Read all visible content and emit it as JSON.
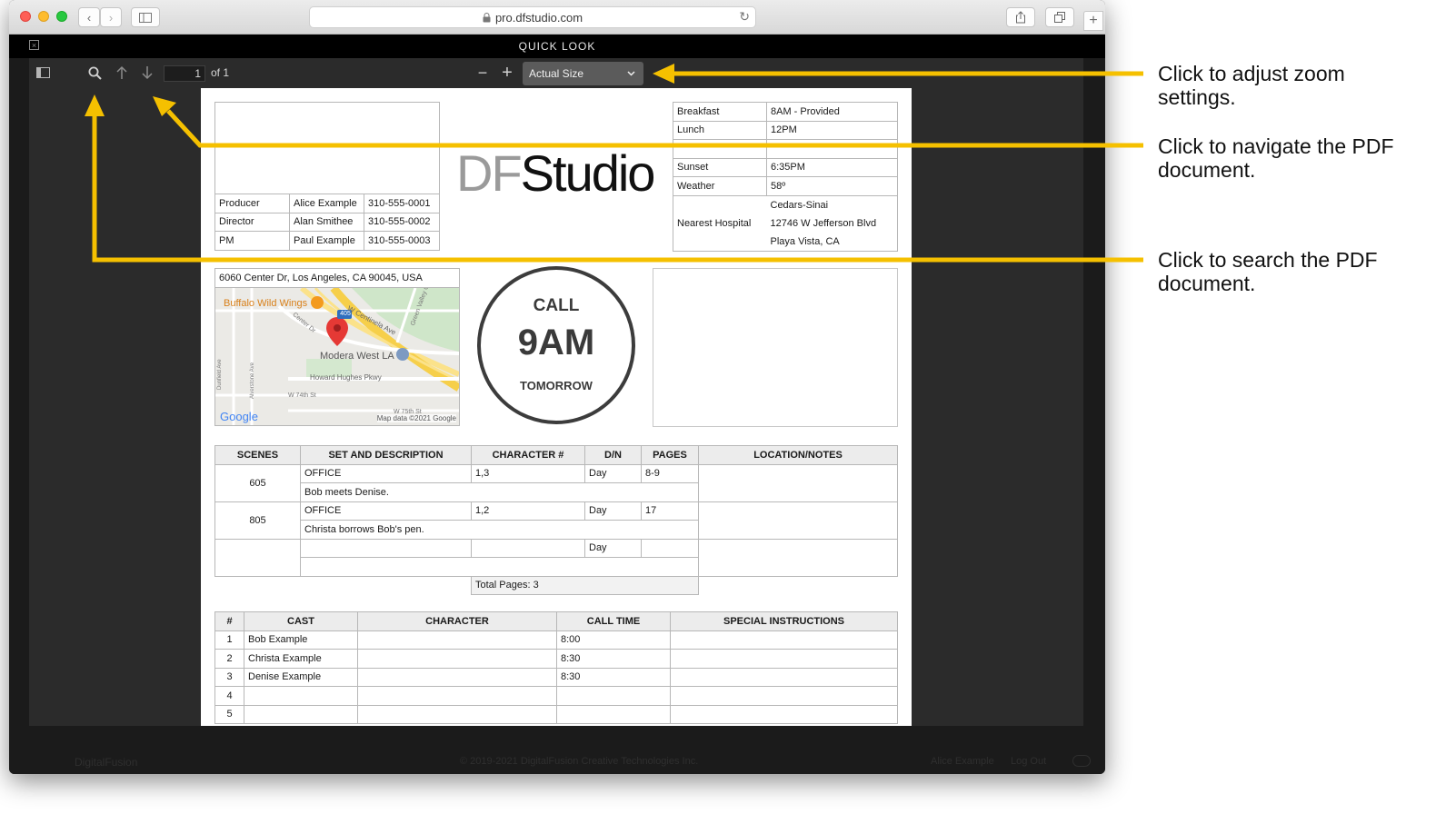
{
  "browser": {
    "url": "pro.dfstudio.com"
  },
  "quicklook": {
    "title": "QUICK LOOK",
    "page_current": "1",
    "page_of": "of 1",
    "zoom_label": "Actual Size"
  },
  "footer": {
    "brand": "DigitalFusion",
    "copyright": "© 2019-2021 DigitalFusion Creative Technologies Inc.",
    "user": "Alice Example",
    "logout": "Log Out"
  },
  "callsheet": {
    "logo_left": "DF",
    "logo_right": "Studio",
    "crew": [
      {
        "role": "Producer",
        "name": "Alice Example",
        "phone": "310-555-0001"
      },
      {
        "role": "Director",
        "name": "Alan Smithee",
        "phone": "310-555-0002"
      },
      {
        "role": "PM",
        "name": "Paul Example",
        "phone": "310-555-0003"
      }
    ],
    "info": {
      "breakfast_label": "Breakfast",
      "breakfast": "8AM - Provided",
      "lunch_label": "Lunch",
      "lunch": "12PM",
      "sunset_label": "Sunset",
      "sunset": "6:35PM",
      "weather_label": "Weather",
      "weather": "58º",
      "hospital_label": "Nearest Hospital",
      "hospital_1": "Cedars-Sinai",
      "hospital_2": "12746 W Jefferson Blvd",
      "hospital_3": "Playa Vista, CA"
    },
    "address": "6060 Center Dr, Los Angeles, CA 90045, USA",
    "map": {
      "poi_1": "Buffalo Wild Wings",
      "poi_2": "Modera West LA",
      "street_1": "W Centinela Ave",
      "street_2": "Howard Hughes Pkwy",
      "street_3": "W 74th St",
      "street_4": "W 75th St",
      "street_5": "Center Dr",
      "street_6": "Green Valley Cir",
      "street_7": "Alverstone Ave",
      "street_8": "Dunfield Ave",
      "highway": "405",
      "google": "Google",
      "attribution": "Map data ©2021 Google"
    },
    "call": {
      "line1": "CALL",
      "time": "9AM",
      "line3": "TOMORROW"
    },
    "scenes_headers": [
      "SCENES",
      "SET AND DESCRIPTION",
      "CHARACTER #",
      "D/N",
      "PAGES",
      "LOCATION/NOTES"
    ],
    "scenes": [
      {
        "scene": "605",
        "set": "OFFICE",
        "chars": "1,3",
        "dn": "Day",
        "pages": "8-9",
        "desc": "Bob meets Denise."
      },
      {
        "scene": "805",
        "set": "OFFICE",
        "chars": "1,2",
        "dn": "Day",
        "pages": "17",
        "desc": "Christa borrows Bob's pen."
      },
      {
        "scene": "",
        "set": "",
        "chars": "",
        "dn": "Day",
        "pages": "",
        "desc": ""
      }
    ],
    "total_pages": "Total Pages: 3",
    "cast_headers": [
      "#",
      "CAST",
      "CHARACTER",
      "CALL TIME",
      "SPECIAL INSTRUCTIONS"
    ],
    "cast": [
      {
        "n": "1",
        "name": "Bob Example",
        "character": "",
        "time": "8:00",
        "notes": ""
      },
      {
        "n": "2",
        "name": "Christa Example",
        "character": "",
        "time": "8:30",
        "notes": ""
      },
      {
        "n": "3",
        "name": "Denise Example",
        "character": "",
        "time": "8:30",
        "notes": ""
      },
      {
        "n": "4",
        "name": "",
        "character": "",
        "time": "",
        "notes": ""
      },
      {
        "n": "5",
        "name": "",
        "character": "",
        "time": "",
        "notes": ""
      }
    ]
  },
  "annotations": {
    "zoom": "Click to adjust zoom settings.",
    "navigate": "Click to navigate the PDF document.",
    "search": "Click to search the PDF document.",
    "arrow_color": "#F5C000"
  }
}
